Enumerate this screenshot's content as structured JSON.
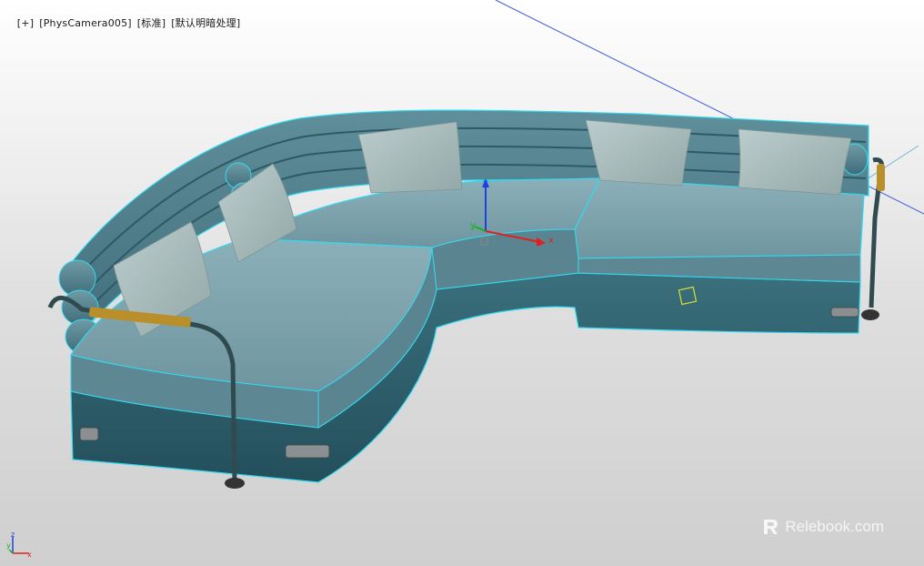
{
  "viewport": {
    "plus_label": "[+]",
    "camera_label": "[PhysCamera005]",
    "shading_label": "[标准]",
    "lighting_label": "[默认明暗处理]"
  },
  "gizmo": {
    "x_label": "x",
    "y_label": "y",
    "z_label": "z"
  },
  "tripod": {
    "x_label": "x",
    "y_label": "y",
    "z_label": "z"
  },
  "watermark": {
    "text": "Relebook.com",
    "icon": "relebook-logo-icon"
  },
  "colors": {
    "sofa_top": "#7fa3ad",
    "sofa_side": "#2f5f6c",
    "selection": "#33d9f0",
    "pillow": "#a9bcbc",
    "camera_line": "#3b5fd6",
    "axis_x": "#e02020",
    "axis_y": "#18b018",
    "axis_z": "#2040e0"
  }
}
